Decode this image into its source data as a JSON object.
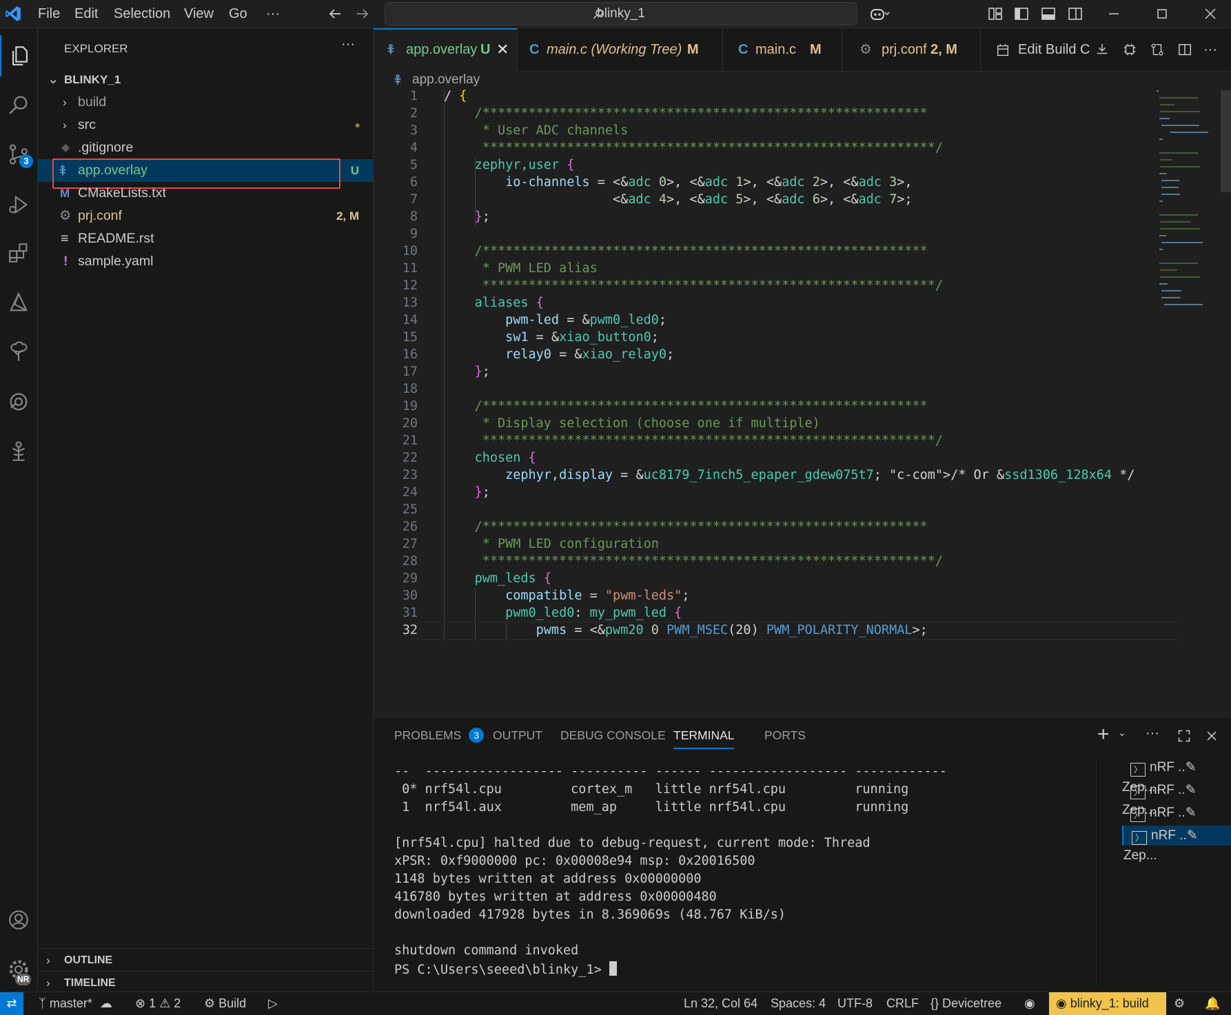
{
  "titlebar": {
    "menus": [
      "File",
      "Edit",
      "Selection",
      "View",
      "Go",
      "···"
    ],
    "search_text": "blinky_1"
  },
  "activity": {
    "scm_badge": "3",
    "manage_badge": "NR"
  },
  "explorer": {
    "title": "EXPLORER",
    "more": "···",
    "folder": "BLINKY_1",
    "items": [
      {
        "label": "build",
        "badge": ""
      },
      {
        "label": "src",
        "badge": "●"
      },
      {
        "label": ".gitignore",
        "badge": ""
      },
      {
        "label": "app.overlay",
        "badge": "U"
      },
      {
        "label": "CMakeLists.txt",
        "badge": ""
      },
      {
        "label": "prj.conf",
        "badge": "2, M"
      },
      {
        "label": "README.rst",
        "badge": ""
      },
      {
        "label": "sample.yaml",
        "badge": ""
      }
    ],
    "outline": "OUTLINE",
    "timeline": "TIMELINE"
  },
  "tabs": [
    {
      "label": "app.overlay",
      "badge": "U"
    },
    {
      "label": "main.c (Working Tree)",
      "badge": "M"
    },
    {
      "label": "main.c",
      "badge": "M"
    },
    {
      "label": "prj.conf",
      "badge": "2, M"
    }
  ],
  "tab_actions": {
    "edit_build": "Edit Build C"
  },
  "breadcrumb": "app.overlay",
  "editor": {
    "current_line": 32,
    "lines": [
      "/ {",
      "    /**********************************************************",
      "     * User ADC channels",
      "     ***********************************************************/",
      "    zephyr,user {",
      "        io-channels = <&adc 0>, <&adc 1>, <&adc 2>, <&adc 3>,",
      "                      <&adc 4>, <&adc 5>, <&adc 6>, <&adc 7>;",
      "    };",
      "",
      "    /**********************************************************",
      "     * PWM LED alias",
      "     ***********************************************************/",
      "    aliases {",
      "        pwm-led = &pwm0_led0;",
      "        sw1 = &xiao_button0;",
      "        relay0 = &xiao_relay0;",
      "    };",
      "",
      "    /**********************************************************",
      "     * Display selection (choose one if multiple)",
      "     ***********************************************************/",
      "    chosen {",
      "        zephyr,display = &uc8179_7inch5_epaper_gdew075t7; /* Or &ssd1306_128x64 */",
      "    };",
      "",
      "    /**********************************************************",
      "     * PWM LED configuration",
      "     ***********************************************************/",
      "    pwm_leds {",
      "        compatible = \"pwm-leds\";",
      "        pwm0_led0: my_pwm_led {",
      "            pwms = <&pwm20 0 PWM_MSEC(20) PWM_POLARITY_NORMAL>;"
    ]
  },
  "panel": {
    "tabs": [
      "PROBLEMS",
      "OUTPUT",
      "DEBUG CONSOLE",
      "TERMINAL",
      "PORTS"
    ],
    "problems_count": "3",
    "terminal_lines": [
      "--  ------------------ ---------- ------ ------------------ ------------",
      " 0* nrf54l.cpu         cortex_m   little nrf54l.cpu         running",
      " 1  nrf54l.aux         mem_ap     little nrf54l.cpu         running",
      "",
      "[nrf54l.cpu] halted due to debug-request, current mode: Thread",
      "xPSR: 0xf9000000 pc: 0x00008e94 msp: 0x20016500",
      "1148 bytes written at address 0x00000000",
      "416780 bytes written at address 0x00000480",
      "downloaded 417928 bytes in 8.369069s (48.767 KiB/s)",
      "",
      "shutdown command invoked",
      "PS C:\\Users\\seeed\\blinky_1> "
    ],
    "terminal_list": [
      "nRF ..✎ Zep...",
      "nRF ..✎ Zep...",
      "nRF ..✎ Zep...",
      "nRF ..✎ Zep..."
    ]
  },
  "statusbar": {
    "branch": "master*",
    "errors": "1",
    "warnings": "2",
    "build": "Build",
    "position": "Ln 32, Col 64",
    "spaces": "Spaces: 4",
    "encoding": "UTF-8",
    "eol": "CRLF",
    "language": "Devicetree",
    "task": "blinky_1: build"
  },
  "colors": {
    "accent": "#0078d4",
    "untracked": "#73c991",
    "modified": "#e2c08d",
    "highlight_box": "#e5484d"
  }
}
